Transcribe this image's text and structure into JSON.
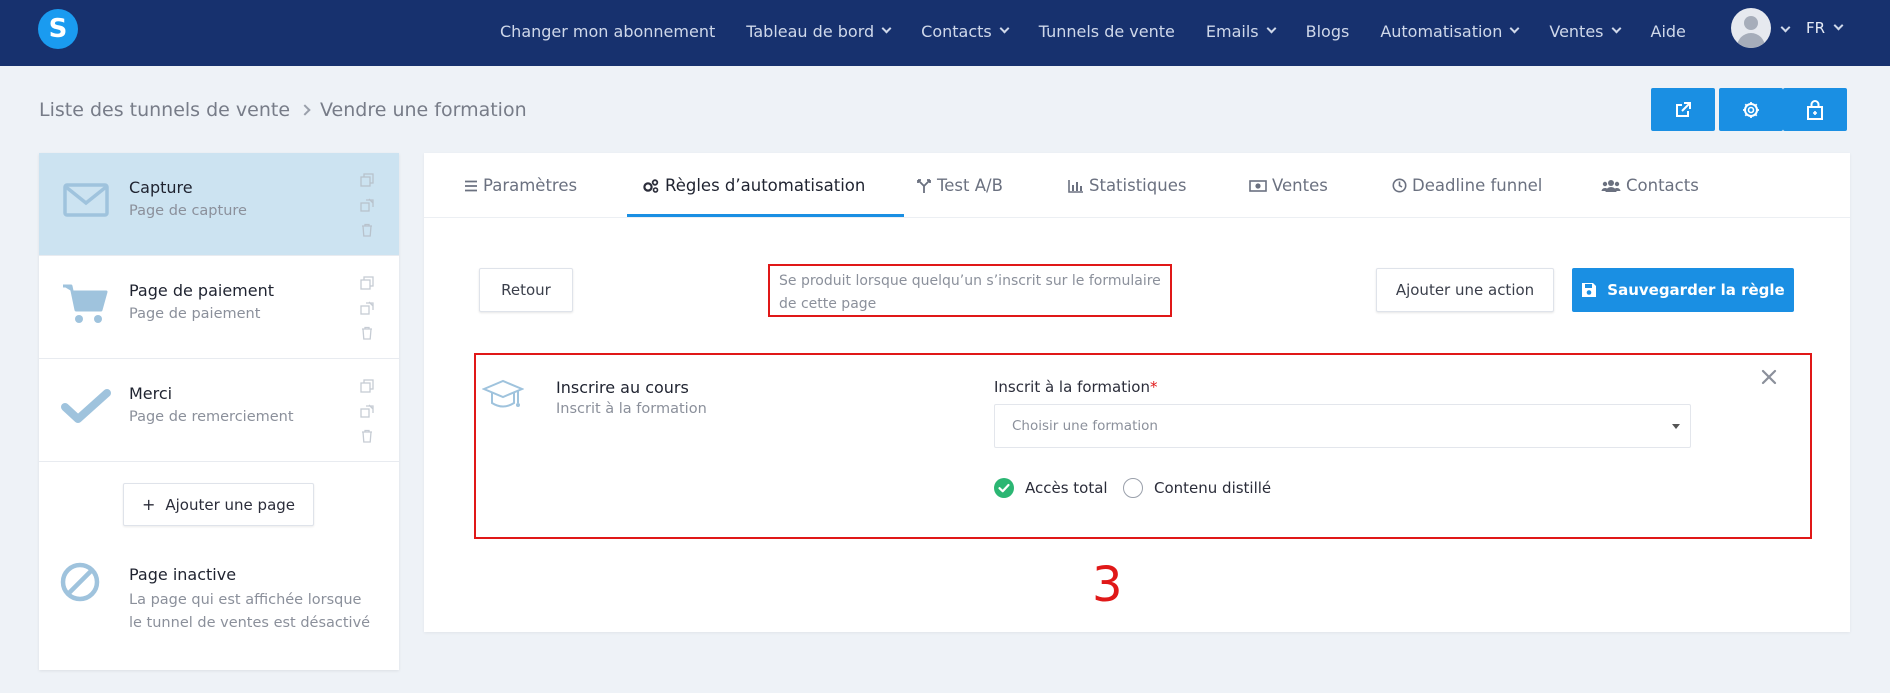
{
  "navbar": {
    "logo_letter": "S",
    "menu": [
      {
        "label": "Changer mon abonnement",
        "has_caret": false
      },
      {
        "label": "Tableau de bord",
        "has_caret": true
      },
      {
        "label": "Contacts",
        "has_caret": true
      },
      {
        "label": "Tunnels de vente",
        "has_caret": false
      },
      {
        "label": "Emails",
        "has_caret": true
      },
      {
        "label": "Blogs",
        "has_caret": false
      },
      {
        "label": "Automatisation",
        "has_caret": true
      },
      {
        "label": "Ventes",
        "has_caret": true
      },
      {
        "label": "Aide",
        "has_caret": false
      }
    ],
    "language": "FR"
  },
  "breadcrumb": {
    "parent": "Liste des tunnels de vente",
    "current": "Vendre une formation"
  },
  "header_buttons": [
    "external-link-icon",
    "gear-icon",
    "shopping-bag-icon"
  ],
  "sidebar": {
    "pages": [
      {
        "title": "Capture",
        "subtitle": "Page de capture",
        "icon": "envelope-icon",
        "active": true
      },
      {
        "title": "Page de paiement",
        "subtitle": "Page de paiement",
        "icon": "cart-icon",
        "active": false
      },
      {
        "title": "Merci",
        "subtitle": "Page de remerciement",
        "icon": "checkmark-icon",
        "active": false
      }
    ],
    "add_page_label": "Ajouter une page",
    "inactive": {
      "title": "Page inactive",
      "description": "La page qui est affichée lorsque le tunnel de ventes est désactivé"
    }
  },
  "tabs": [
    {
      "label": "Paramètres",
      "icon": "list-icon",
      "active": false
    },
    {
      "label": "Règles d’automatisation",
      "icon": "gears-icon",
      "active": true
    },
    {
      "label": "Test A/B",
      "icon": "split-icon",
      "active": false
    },
    {
      "label": "Statistiques",
      "icon": "bar-chart-icon",
      "active": false
    },
    {
      "label": "Ventes",
      "icon": "money-icon",
      "active": false
    },
    {
      "label": "Deadline funnel",
      "icon": "clock-icon",
      "active": false
    },
    {
      "label": "Contacts",
      "icon": "users-icon",
      "active": false
    }
  ],
  "rule": {
    "back_label": "Retour",
    "trigger_text": "Se produit lorsque quelqu’un s’inscrit sur le formulaire de cette page",
    "add_action_label": "Ajouter une action",
    "save_label": "Sauvegarder la règle"
  },
  "action": {
    "title": "Inscrire au cours",
    "subtitle": "Inscrit à la formation",
    "field_label": "Inscrit à la formation",
    "required_mark": "*",
    "select_placeholder": "Choisir une formation",
    "options": [
      {
        "label": "Accès total",
        "checked": true
      },
      {
        "label": "Contenu distillé",
        "checked": false
      }
    ]
  },
  "annotation": "3",
  "colors": {
    "navbar": "#17316e",
    "accent": "#1a8fe3",
    "active_page": "#cce3f1",
    "highlight": "#e01818",
    "success": "#2bb673"
  }
}
